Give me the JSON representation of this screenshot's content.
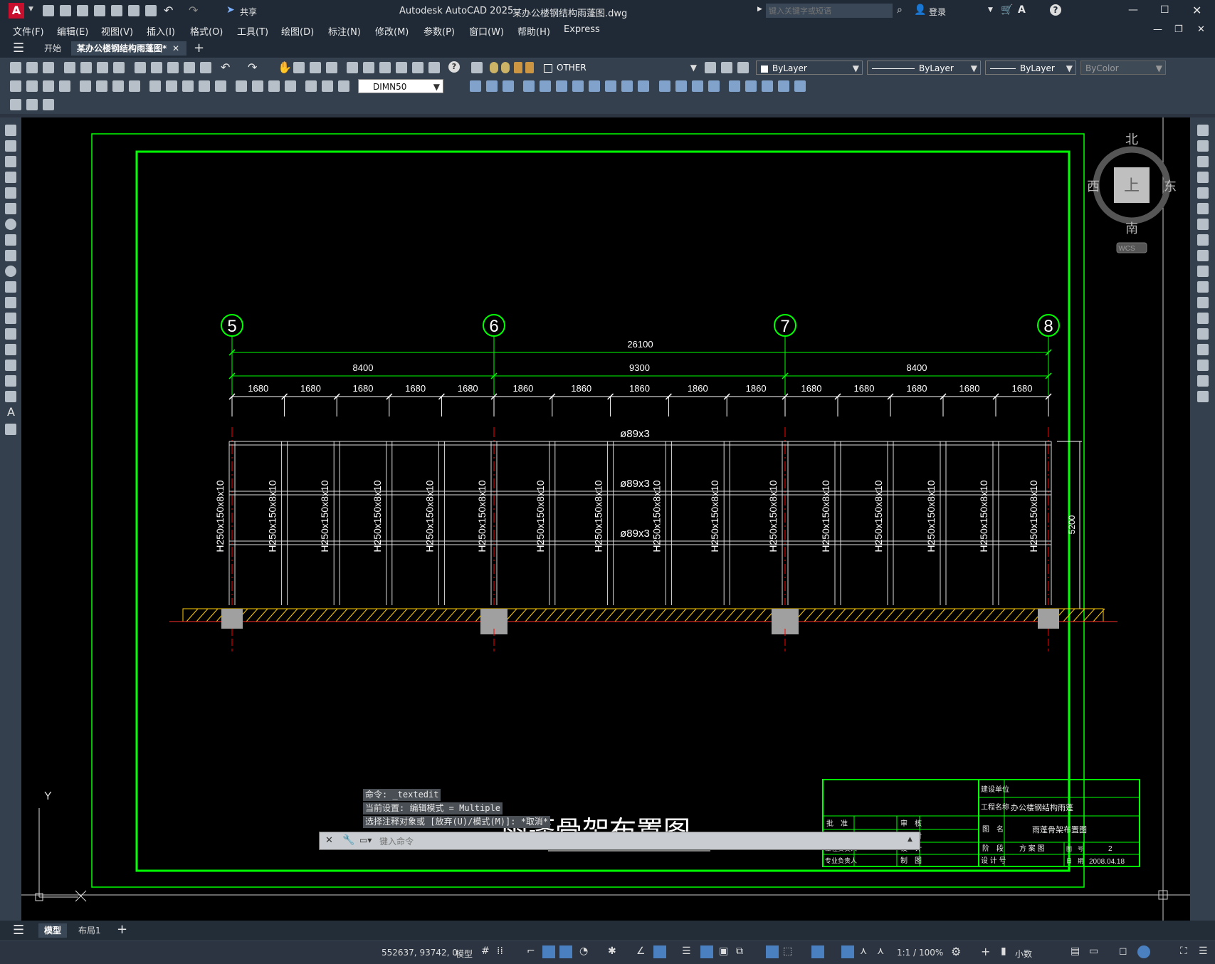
{
  "app": {
    "logo_letter": "A",
    "title": "Autodesk AutoCAD 2025",
    "filename": "某办公楼钢结构雨蓬图.dwg",
    "search_placeholder": "键入关键字或短语",
    "share_label": "共享",
    "login_label": "登录"
  },
  "menus": [
    "文件(F)",
    "编辑(E)",
    "视图(V)",
    "插入(I)",
    "格式(O)",
    "工具(T)",
    "绘图(D)",
    "标注(N)",
    "修改(M)",
    "参数(P)",
    "窗口(W)",
    "帮助(H)",
    "Express"
  ],
  "doc_tabs": {
    "start": "开始",
    "active": "某办公楼钢结构雨蓬图*"
  },
  "toolbar": {
    "layer_name": "OTHER",
    "color": "ByLayer",
    "linetype": "ByLayer",
    "lineweight": "ByLayer",
    "plotstyle": "ByColor",
    "dimstyle": "DIMN50"
  },
  "viewcube": {
    "north": "北",
    "south": "南",
    "east": "东",
    "west": "西",
    "top": "上",
    "wcs": "WCS"
  },
  "drawing": {
    "axes": [
      "5",
      "6",
      "7",
      "8"
    ],
    "overall_dim": "26100",
    "bay_dims": [
      "8400",
      "9300",
      "8400"
    ],
    "sub_dims": [
      "1680",
      "1680",
      "1680",
      "1680",
      "1680",
      "1860",
      "1860",
      "1860",
      "1860",
      "1860",
      "1680",
      "1680",
      "1680",
      "1680",
      "1680"
    ],
    "pipe_labels": [
      "ø89x3",
      "ø89x3",
      "ø89x3"
    ],
    "column_label": "H250x150x8x10",
    "height_dim": "5200",
    "title": "雨蓬骨架布置图",
    "ucs_y": "Y"
  },
  "title_block": {
    "build_unit": "建设单位",
    "project_name_label": "工程名称",
    "project_name": "办公楼钢结构雨蓬",
    "approve": "批　准",
    "review": "审　核",
    "examine": "审　定",
    "check": "校　对",
    "proj_lead": "工程负责人",
    "design": "设　计",
    "spec_lead": "专业负责人",
    "draw": "制　图",
    "drawing_name_label": "图　名",
    "drawing_name": "雨蓬骨架布置图",
    "stage_label": "阶　段",
    "stage": "方 案 图",
    "number_label": "图　号",
    "number": "2",
    "design_no_label": "设 计 号",
    "date_label": "日　期",
    "date": "2008.04.18"
  },
  "command": {
    "history": [
      "命令: _textedit",
      "当前设置: 编辑模式 = Multiple",
      "选择注释对象或 [放弃(U)/模式(M)]: *取消*"
    ],
    "placeholder": "键入命令"
  },
  "layout_tabs": {
    "model": "模型",
    "layout1": "布局1"
  },
  "status": {
    "coords": "552637, 93742, 0",
    "space": "模型",
    "scale": "1:1 / 100%",
    "units": "小数"
  }
}
